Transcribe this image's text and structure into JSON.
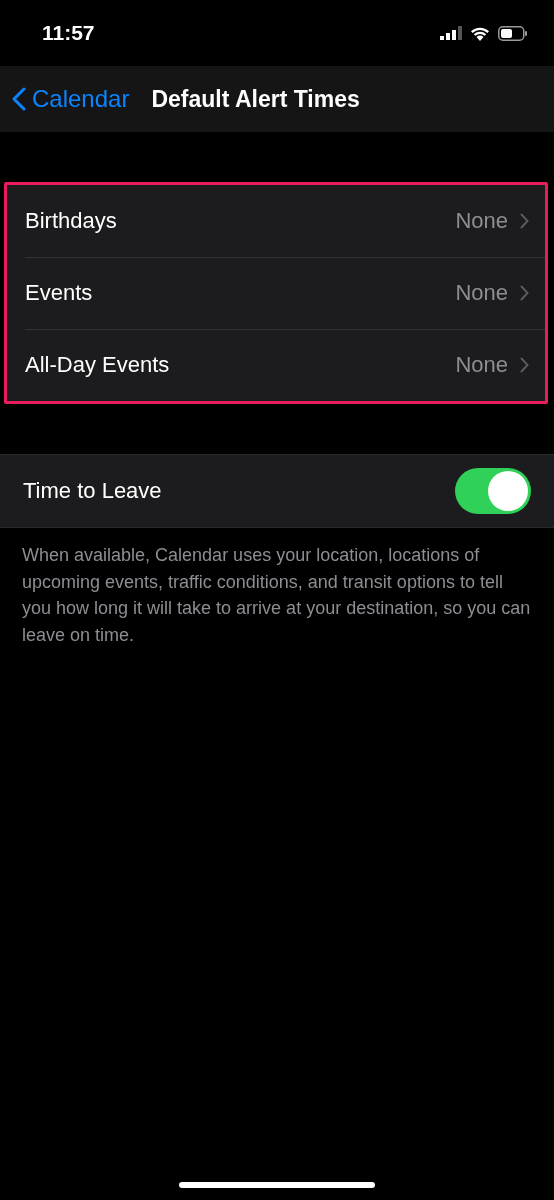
{
  "status_bar": {
    "time": "11:57"
  },
  "nav": {
    "back": "Calendar",
    "title": "Default Alert Times"
  },
  "alert_group": {
    "highlighted": true,
    "rows": [
      {
        "label": "Birthdays",
        "value": "None"
      },
      {
        "label": "Events",
        "value": "None"
      },
      {
        "label": "All-Day Events",
        "value": "None"
      }
    ]
  },
  "toggle_row": {
    "label": "Time to Leave",
    "on": true
  },
  "footer": "When available, Calendar uses your location, locations of upcoming events, traffic conditions, and transit options to tell you how long it will take to arrive at your destination, so you can leave on time."
}
